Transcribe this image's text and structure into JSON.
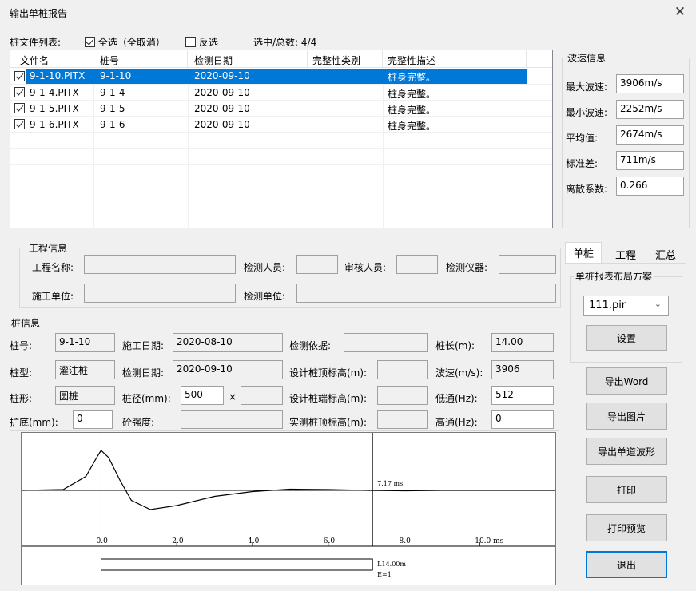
{
  "window": {
    "title": "输出单桩报告",
    "close_glyph": "✕"
  },
  "filelist": {
    "label": "桩文件列表:",
    "select_all_label": "全选（全取消）",
    "select_all_checked": true,
    "invert_label": "反选",
    "invert_checked": false,
    "count_label": "选中/总数: 4/4",
    "columns": [
      "文件名",
      "桩号",
      "检测日期",
      "完整性类别",
      "完整性描述"
    ],
    "rows": [
      {
        "file": "9-1-10.PITX",
        "pile": "9-1-10",
        "date": "2020-09-10",
        "category": "",
        "desc": "桩身完整。",
        "checked": true,
        "selected": true
      },
      {
        "file": "9-1-4.PITX",
        "pile": "9-1-4",
        "date": "2020-09-10",
        "category": "",
        "desc": "桩身完整。",
        "checked": true,
        "selected": false
      },
      {
        "file": "9-1-5.PITX",
        "pile": "9-1-5",
        "date": "2020-09-10",
        "category": "",
        "desc": "桩身完整。",
        "checked": true,
        "selected": false
      },
      {
        "file": "9-1-6.PITX",
        "pile": "9-1-6",
        "date": "2020-09-10",
        "category": "",
        "desc": "桩身完整。",
        "checked": true,
        "selected": false
      }
    ]
  },
  "wave_info": {
    "title": "波速信息",
    "max_label": "最大波速:",
    "max_value": "3906m/s",
    "min_label": "最小波速:",
    "min_value": "2252m/s",
    "avg_label": "平均值:",
    "avg_value": "2674m/s",
    "std_label": "标准差:",
    "std_value": "711m/s",
    "cv_label": "离散系数:",
    "cv_value": "0.266"
  },
  "project": {
    "title": "工程信息",
    "name_label": "工程名称:",
    "name_value": "",
    "inspector_label": "检测人员:",
    "inspector_value": "",
    "reviewer_label": "审核人员:",
    "reviewer_value": "",
    "instrument_label": "检测仪器:",
    "instrument_value": "",
    "builder_label": "施工单位:",
    "builder_value": "",
    "test_unit_label": "检测单位:",
    "test_unit_value": ""
  },
  "pile": {
    "title": "桩信息",
    "no_label": "桩号:",
    "no_value": "9-1-10",
    "build_date_label": "施工日期:",
    "build_date_value": "2020-08-10",
    "basis_label": "检测依据:",
    "basis_value": "",
    "length_label": "桩长(m):",
    "length_value": "14.00",
    "type_label": "桩型:",
    "type_value": "灌注桩",
    "test_date_label": "检测日期:",
    "test_date_value": "2020-09-10",
    "design_top_label": "设计桩顶标高(m):",
    "design_top_value": "",
    "speed_label": "波速(m/s):",
    "speed_value": "3906",
    "shape_label": "桩形:",
    "shape_value": "圆桩",
    "diameter_label": "桩径(mm):",
    "diameter_value": "500",
    "diameter_x": "×",
    "diameter_value2": "",
    "design_end_label": "设计桩端标高(m):",
    "design_end_value": "",
    "lowpass_label": "低通(Hz):",
    "lowpass_value": "512",
    "flare_label": "扩底(mm):",
    "flare_value": "0",
    "concrete_label": "砼强度:",
    "concrete_value": "",
    "actual_top_label": "实测桩顶标高(m):",
    "actual_top_value": "",
    "highpass_label": "高通(Hz):",
    "highpass_value": "0"
  },
  "chart_data": {
    "type": "line",
    "x_unit": "ms",
    "x_ticks": [
      "0.0",
      "2.0",
      "4.0",
      "6.0",
      "8.0",
      "10.0 ms"
    ],
    "xlim": [
      -2.1,
      12.0
    ],
    "marker_label": "7.17 ms",
    "marker_x": 7.17,
    "series": [
      {
        "x": [
          -2.1,
          -1.0,
          -0.4,
          -0.1,
          0.0,
          0.2,
          0.5,
          0.8,
          1.3,
          2.0,
          3.0,
          4.0,
          5.0,
          6.0,
          7.0,
          8.0,
          9.0,
          10.0,
          11.0,
          12.0
        ],
        "y": [
          0,
          0.02,
          0.35,
          0.85,
          1.0,
          0.82,
          0.25,
          -0.25,
          -0.48,
          -0.38,
          -0.15,
          -0.03,
          0.03,
          0.02,
          0.0,
          -0.01,
          0.0,
          0.0,
          0.0,
          0.0
        ]
      }
    ],
    "pile_label": "L14.00m",
    "pile_label2": "E=1"
  },
  "tabs": {
    "single": "单桩",
    "project": "工程",
    "summary": "汇总"
  },
  "layout_plan": {
    "title": "单桩报表布局方案",
    "selected": "111.pir",
    "settings_button": "设置"
  },
  "buttons": {
    "export_word": "导出Word",
    "export_image": "导出图片",
    "export_wave": "导出单道波形",
    "print": "打印",
    "print_preview": "打印预览",
    "exit": "退出"
  }
}
